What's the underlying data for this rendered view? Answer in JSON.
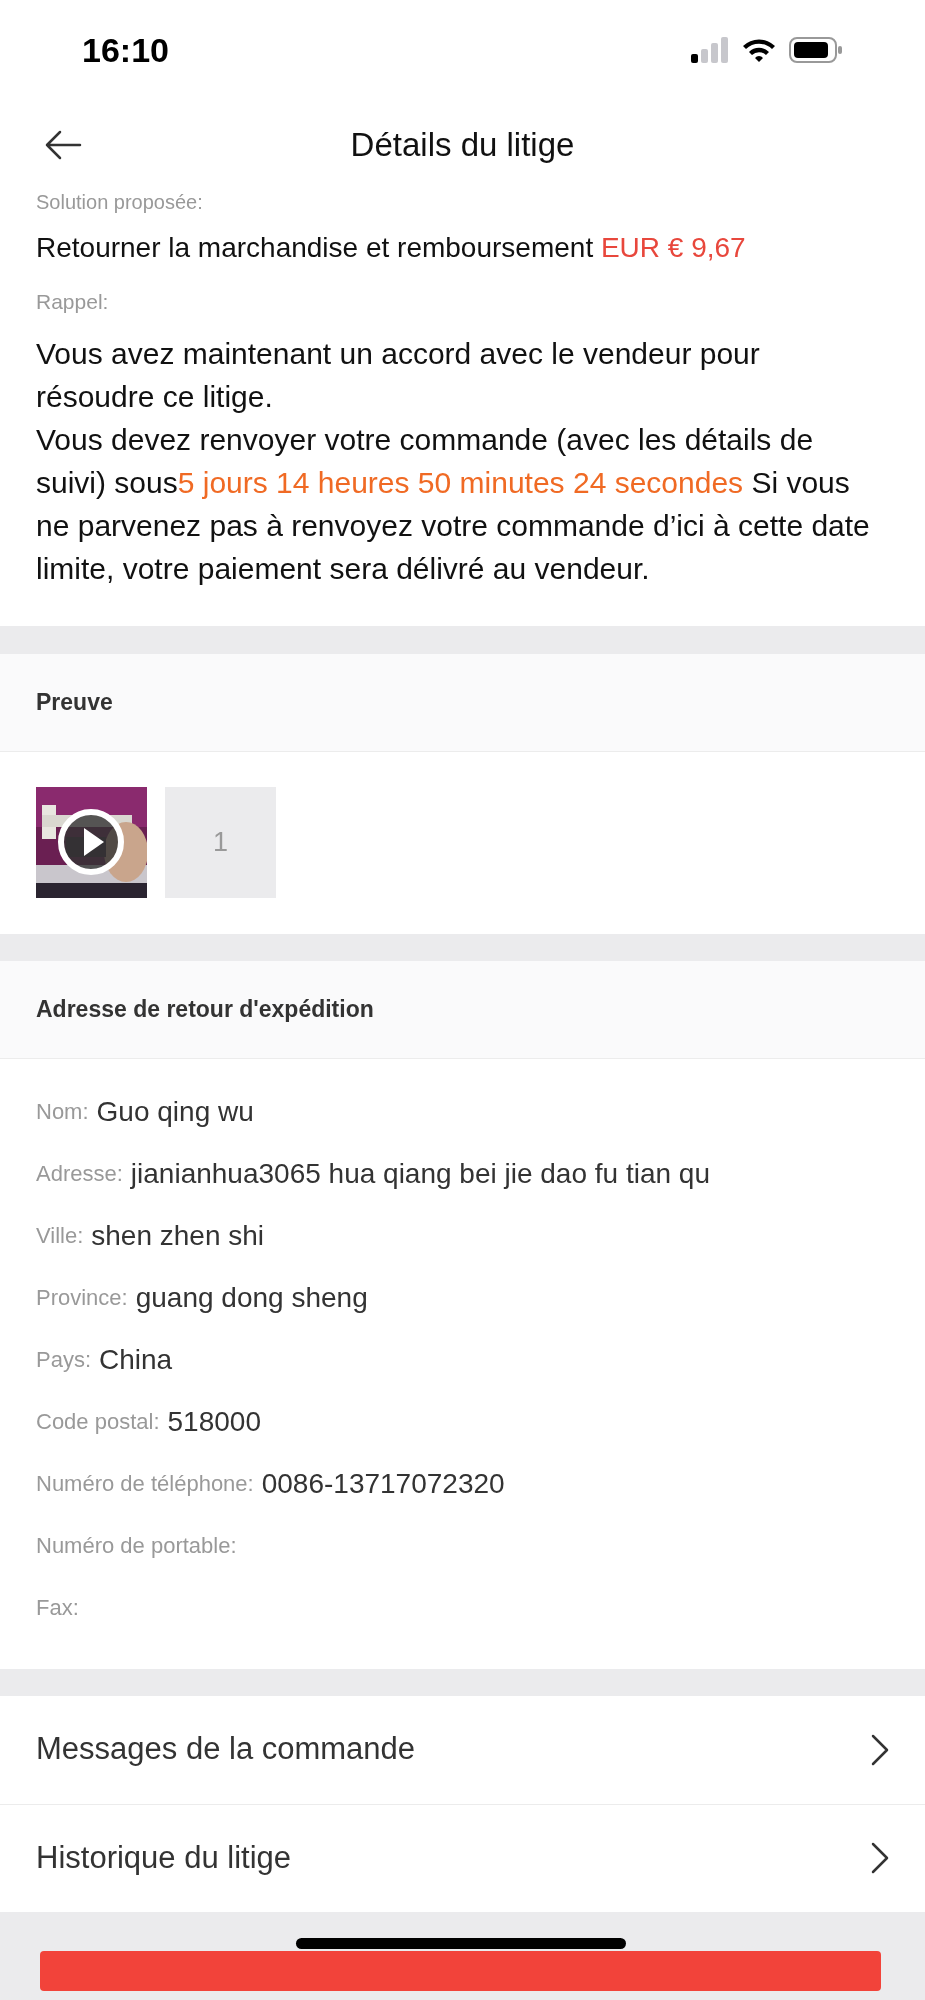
{
  "status_bar": {
    "time": "16:10"
  },
  "nav": {
    "title": "Détails du litige"
  },
  "solution": {
    "label": "Solution proposée:",
    "text": "Retourner la marchandise et remboursement",
    "amount": "EUR € 9,67"
  },
  "reminder": {
    "label": "Rappel:",
    "paragraphs": [
      [
        {
          "kind": "normal",
          "text": "Vous avez maintenant un accord avec le vendeur pour résoudre ce litige."
        }
      ],
      [
        {
          "kind": "normal",
          "text": "Vous devez renvoyer votre commande (avec les détails de suivi) sous"
        },
        {
          "kind": "countdown",
          "text": "5 jours 14 heures 50 minutes 24 secondes"
        },
        {
          "kind": "normal",
          "text": " Si vous ne parvenez pas à renvoyez votre commande d’ici à cette date limite, votre paiement sera délivré au vendeur."
        }
      ]
    ]
  },
  "evidence": {
    "title": "Preuve",
    "items": [
      {
        "kind": "video"
      },
      {
        "kind": "count",
        "text": "1"
      }
    ]
  },
  "return_address": {
    "title": "Adresse de retour d'expédition",
    "fields": [
      {
        "label": "Nom:",
        "value": "Guo qing wu"
      },
      {
        "label": "Adresse:",
        "value": "jianianhua3065 hua qiang bei jie dao fu tian qu"
      },
      {
        "label": "Ville:",
        "value": "shen zhen shi"
      },
      {
        "label": "Province:",
        "value": "guang dong sheng"
      },
      {
        "label": "Pays:",
        "value": "China"
      },
      {
        "label": "Code postal:",
        "value": "518000"
      },
      {
        "label": "Numéro de téléphone:",
        "value": "0086-13717072320"
      },
      {
        "label": "Numéro de portable:"
      },
      {
        "label": "Fax:"
      }
    ]
  },
  "links": [
    {
      "label": "Messages de la commande"
    },
    {
      "label": "Historique du litige"
    }
  ]
}
